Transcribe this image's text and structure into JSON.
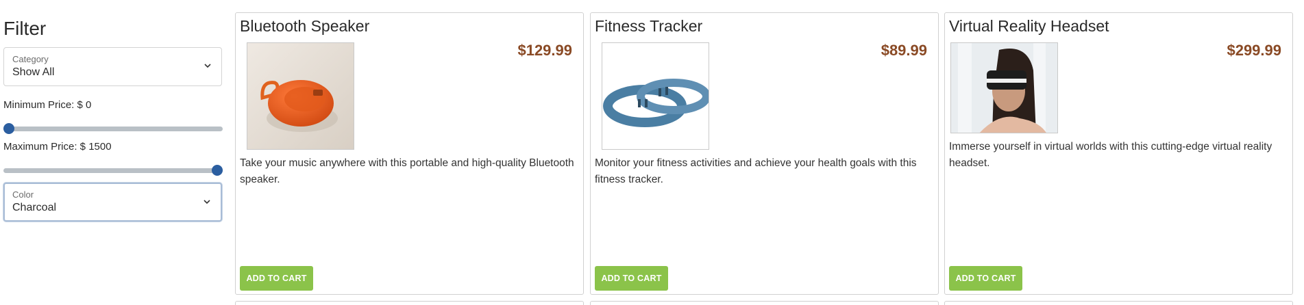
{
  "sidebar": {
    "title": "Filter",
    "category": {
      "label": "Category",
      "value": "Show All"
    },
    "min_price": {
      "label": "Minimum Price: $ 0",
      "fraction": 0
    },
    "max_price": {
      "label": "Maximum Price: $ 1500",
      "fraction": 1
    },
    "color": {
      "label": "Color",
      "value": "Charcoal"
    }
  },
  "products": [
    {
      "title": "Bluetooth Speaker",
      "price": "$129.99",
      "description": "Take your music anywhere with this portable and high-quality Bluetooth speaker.",
      "button": "ADD TO CART",
      "image": "orange-speaker-on-sand"
    },
    {
      "title": "Fitness Tracker",
      "price": "$89.99",
      "description": "Monitor your fitness activities and achieve your health goals with this fitness tracker.",
      "button": "ADD TO CART",
      "image": "blue-fitness-bands"
    },
    {
      "title": "Virtual Reality Headset",
      "price": "$299.99",
      "description": "Immerse yourself in virtual worlds with this cutting-edge virtual reality headset.",
      "button": "ADD TO CART",
      "image": "woman-wearing-vr-headset"
    }
  ],
  "colors": {
    "price": "#8a4a25",
    "button": "#8bc34a",
    "slider_thumb": "#2b5ea0"
  }
}
